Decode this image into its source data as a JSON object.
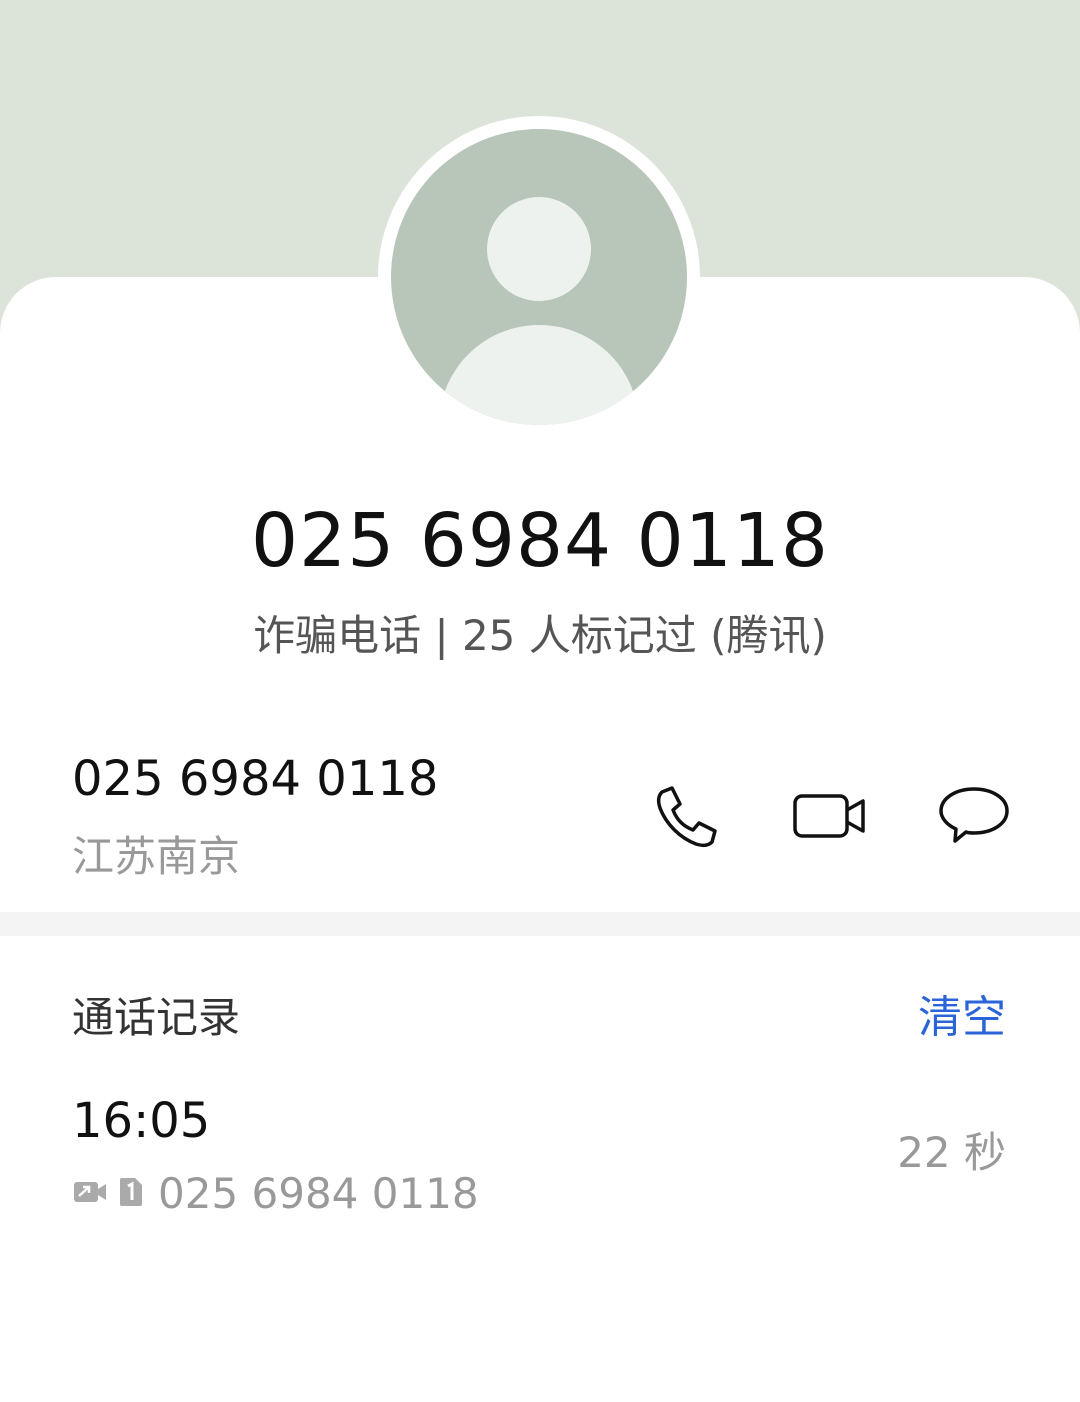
{
  "header": {
    "phone_number": "025 6984 0118",
    "tag": "诈骗电话 | 25 人标记过 (腾讯)"
  },
  "number_row": {
    "number": "025 6984 0118",
    "location": "江苏南京",
    "actions": [
      "phone-icon",
      "video-call-icon",
      "message-icon"
    ]
  },
  "call_log": {
    "title": "通话记录",
    "clear_label": "清空",
    "entries": [
      {
        "time": "16:05",
        "type_icon": "video-call-small-icon",
        "sim_icon": "sim-1-icon",
        "number": "025 6984 0118",
        "duration": "22 秒"
      }
    ]
  },
  "colors": {
    "header_bg": "#dce4da",
    "avatar_bg": "#b8c5b9",
    "accent": "#2a64d8"
  }
}
